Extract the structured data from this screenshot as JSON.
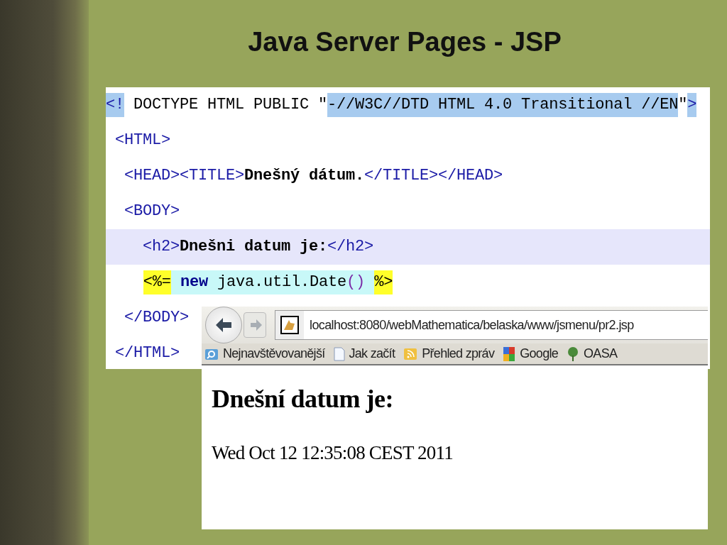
{
  "slide": {
    "title": "Java Server Pages - JSP"
  },
  "code_panel": {
    "lines": [
      {
        "current": false,
        "segments": [
          {
            "kind": "tag",
            "text": "<!",
            "selected": true
          },
          {
            "kind": "text",
            "text": " DOCTYPE HTML PUBLIC \"",
            "selected": false
          },
          {
            "kind": "text",
            "text": "-//W3C//DTD HTML 4.0 Transitional //EN",
            "selected": true
          },
          {
            "kind": "text",
            "text": "\"",
            "selected": false
          },
          {
            "kind": "tag",
            "text": ">",
            "selected": true
          }
        ]
      },
      {
        "current": false,
        "segments": [
          {
            "kind": "tag",
            "text": " <HTML>"
          }
        ]
      },
      {
        "current": false,
        "segments": [
          {
            "kind": "tag",
            "text": "  <HEAD><TITLE>"
          },
          {
            "kind": "text",
            "text": "Dnešný dátum."
          },
          {
            "kind": "tag",
            "text": "</TITLE></HEAD>"
          }
        ]
      },
      {
        "current": false,
        "segments": [
          {
            "kind": "tag",
            "text": "  <BODY>"
          }
        ]
      },
      {
        "current": true,
        "segments": [
          {
            "kind": "tag",
            "text": "    <h2>"
          },
          {
            "kind": "text",
            "text": "Dnešni datum je:"
          },
          {
            "kind": "tag",
            "text": "</h2>"
          }
        ]
      },
      {
        "current": false,
        "segments": [
          {
            "kind": "delim",
            "text": "<%="
          },
          {
            "kind": "keyword",
            "text": "new"
          },
          {
            "kind": "code",
            "text": " java.util.Date"
          },
          {
            "kind": "paren",
            "text": "()"
          },
          {
            "kind": "delim",
            "text": "%>"
          }
        ]
      },
      {
        "current": false,
        "segments": [
          {
            "kind": "tag",
            "text": "  </BODY>"
          }
        ]
      },
      {
        "current": false,
        "segments": [
          {
            "kind": "tag",
            "text": " </HTML>"
          }
        ]
      }
    ]
  },
  "browser": {
    "url": "localhost:8080/webMathematica/belaska/www/jsmenu/pr2.jsp",
    "bookmarks": [
      {
        "kind": "folder",
        "label": "Nejnavštěvovanější"
      },
      {
        "kind": "page",
        "label": "Jak začít"
      },
      {
        "kind": "feed",
        "label": "Přehled zpráv"
      },
      {
        "kind": "blocks",
        "label": "Google"
      },
      {
        "kind": "tree",
        "label": "OASA"
      }
    ],
    "heading": "Dnešní datum je:",
    "body": "Wed Oct 12 12:35:08 CEST 2011"
  }
}
